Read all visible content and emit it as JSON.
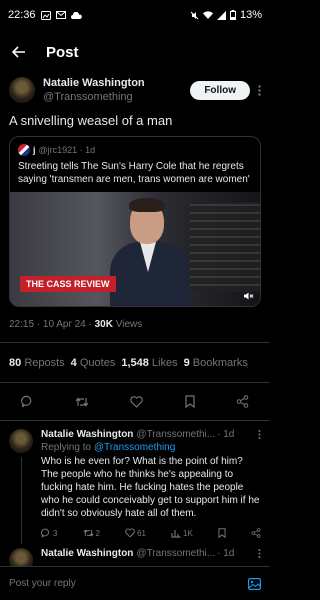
{
  "status": {
    "time": "22:36",
    "battery": "13%"
  },
  "header": {
    "title": "Post"
  },
  "tweet": {
    "name": "Natalie Washington",
    "handle": "@Transsomething",
    "follow_label": "Follow",
    "text": "A snivelling weasel of a man",
    "quote": {
      "author": "j",
      "handle_time": "@jrc1921 · 1d",
      "text": "Streeting tells The Sun's Harry Cole that he regrets saying 'transmen are men, trans women are women'",
      "banner": "THE CASS REVIEW"
    },
    "time": "22:15 · 10 Apr 24 · ",
    "views_count": "30K",
    "views_label": " Views",
    "stats": {
      "reposts_count": "80",
      "reposts_label": "Reposts",
      "quotes_count": "4",
      "quotes_label": "Quotes",
      "likes_count": "1,548",
      "likes_label": "Likes",
      "bookmarks_count": "9",
      "bookmarks_label": "Bookmarks"
    }
  },
  "replies": [
    {
      "name": "Natalie Washington",
      "handle": "@Transsomethi...",
      "time": "· 1d",
      "replying_prefix": "Replying to ",
      "replying_to": "@Transsomething",
      "text": "Who is he even for? What is the point of him? The people who he thinks he's appealing to fucking hate him. He fucking hates the people who he could conceivably get to support him if he didn't so obviously hate all of them.",
      "replies": "3",
      "reposts": "2",
      "likes": "61",
      "views": "1K"
    },
    {
      "name": "Natalie Washington",
      "handle": "@Transsomethi...",
      "time": "· 1d"
    }
  ],
  "composer": {
    "placeholder": "Post your reply"
  }
}
